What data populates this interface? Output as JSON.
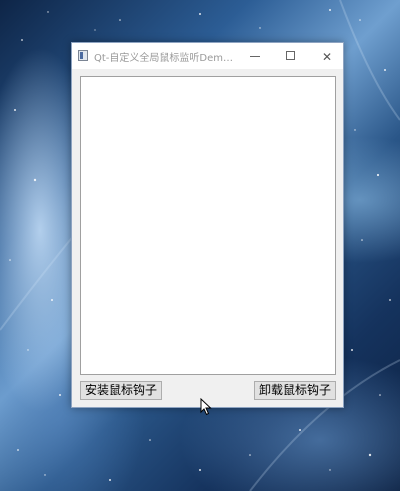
{
  "window": {
    "title": "Qt-自定义全局鼠标监听Demo...",
    "minimize_icon": "minimize-icon",
    "maximize_icon": "maximize-icon",
    "close_icon": "close-icon",
    "close_glyph": "✕"
  },
  "main": {
    "log_text": ""
  },
  "buttons": {
    "install_label": "安装鼠标钩子",
    "uninstall_label": "卸载鼠标钩子"
  },
  "colors": {
    "window_border": "#8ea4c2",
    "button_bg": "#e1e1e1"
  }
}
